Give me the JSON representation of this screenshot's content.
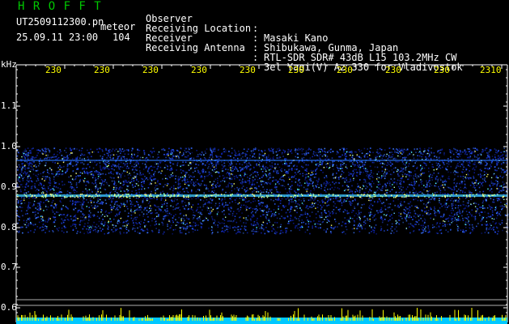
{
  "header": {
    "brand": "H R O F F T",
    "filename": "UT2509112300.pn",
    "meteor_label": "meteor",
    "datetime": "25.09.11 23:00",
    "count": "104"
  },
  "info": [
    {
      "label": "Observer",
      "colon": ":",
      "value": "Masaki Kano"
    },
    {
      "label": "Receiving Location",
      "colon": ":",
      "value": "Shibukawa, Gunma, Japan"
    },
    {
      "label": "Receiver",
      "colon": ":",
      "value": "RTL-SDR SDR# 43dB L15 103.2MHz CW"
    },
    {
      "label": "Receiving Antenna",
      "colon": ":",
      "value": "3el Yagi(V) Az 330 for Vladivostok"
    }
  ],
  "axis": {
    "y_unit": "kHz",
    "y_ticks": [
      "1.1",
      "1.0",
      "0.9",
      "0.8",
      "0.7",
      "0.6"
    ],
    "x_ticks": [
      "230",
      "230",
      "230",
      "230",
      "230",
      "230",
      "230",
      "230",
      "230",
      "2310"
    ]
  },
  "colors": {
    "brand": "#00c800",
    "x_ticks": "#ffff00",
    "baseline_fill": "#00c8ff",
    "baseline_spikes": "#ffff00",
    "signal": "#2050ff"
  }
}
